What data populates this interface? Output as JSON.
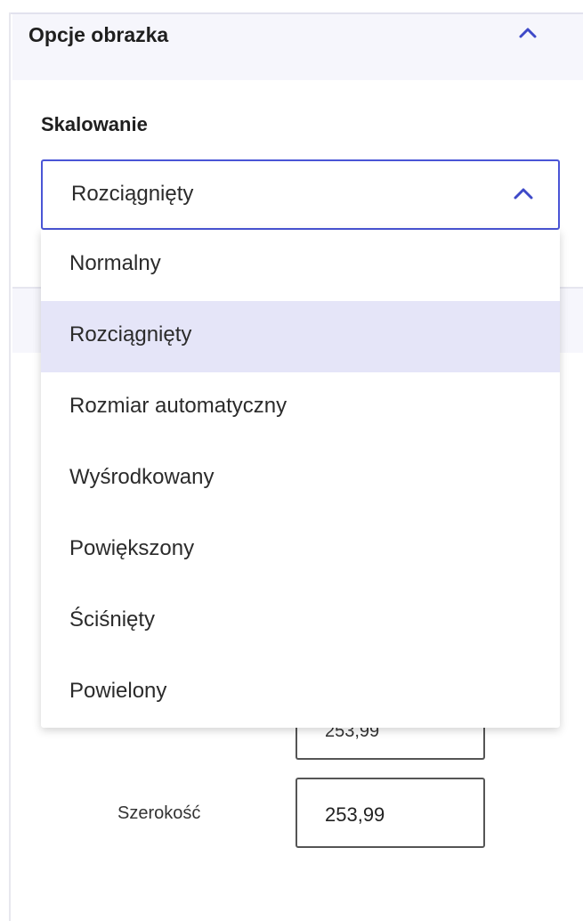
{
  "section": {
    "title": "Opcje obrazka",
    "collapse_icon": "chevron-up-icon"
  },
  "scaling": {
    "label": "Skalowanie",
    "selected": "Rozciągnięty",
    "options": [
      "Normalny",
      "Rozciągnięty",
      "Rozmiar automatyczny",
      "Wyśrodkowany",
      "Powiększony",
      "Ściśnięty",
      "Powielony"
    ]
  },
  "dimensions": {
    "height_value": "253,99",
    "width_label": "Szerokość",
    "width_value": "253,99"
  },
  "colors": {
    "accent": "#4a55d6",
    "selected_bg": "#e5e5f8",
    "header_bg": "#f6f6fc"
  }
}
